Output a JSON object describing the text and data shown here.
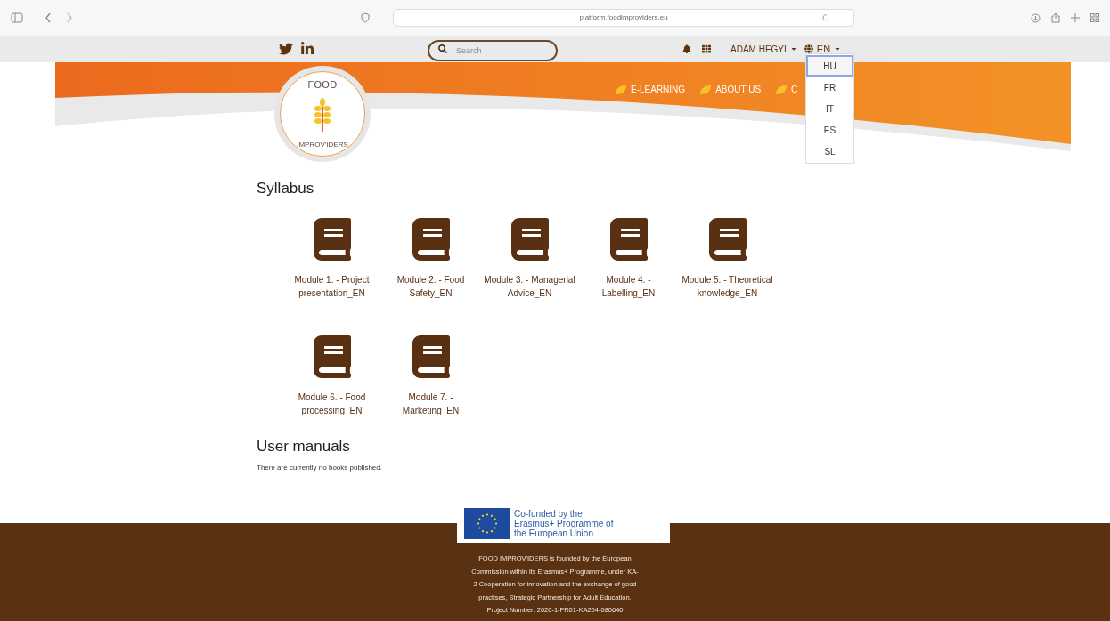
{
  "browser": {
    "url": "platform.foodimproviders.eu"
  },
  "topbar": {
    "search": {
      "placeholder": "Search"
    },
    "user": "ÁDÁM HEGYI",
    "language": "EN"
  },
  "language_menu": [
    {
      "label": "HU",
      "selected": true
    },
    {
      "label": "FR",
      "selected": false
    },
    {
      "label": "IT",
      "selected": false
    },
    {
      "label": "ES",
      "selected": false
    },
    {
      "label": "SL",
      "selected": false
    }
  ],
  "logo": {
    "top": "FOOD",
    "bottom": "IMPROV'IDERS"
  },
  "nav": [
    {
      "label": "E-LEARNING"
    },
    {
      "label": "ABOUT US"
    },
    {
      "label": "C"
    }
  ],
  "syllabus": {
    "title": "Syllabus",
    "modules": [
      {
        "label": "Module 1. - Project presentation_EN"
      },
      {
        "label": "Module 2. - Food Safety_EN"
      },
      {
        "label": "Module 3. - Managerial Advice_EN"
      },
      {
        "label": "Module 4. - Labelling_EN"
      },
      {
        "label": "Module 5. - Theoretical knowledge_EN"
      },
      {
        "label": "Module 6. - Food processing_EN"
      },
      {
        "label": "Module 7. - Marketing_EN"
      }
    ]
  },
  "user_manuals": {
    "title": "User manuals",
    "text": "There are currently no books published."
  },
  "footer": {
    "eu_text": "Co-funded by the Erasmus+ Programme of the European Union",
    "lines": [
      "FOOD IMPROV'IDERS is founded by the European",
      "Commission within its Erasmus+ Programme, under KA-",
      "2 Cooperation for innovation and the exchange of good",
      "practises, Strategic Partnership for Adult Education.",
      "Project Number: 2020-1-FR01-KA204-080640"
    ]
  }
}
